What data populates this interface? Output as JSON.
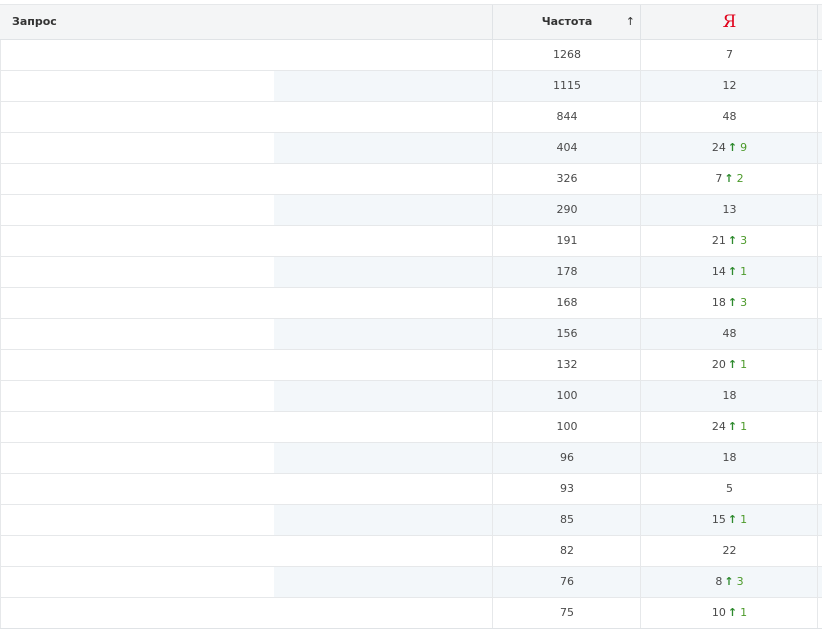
{
  "header": {
    "query_label": "Запрос",
    "freq_label": "Частота",
    "sort_glyph": "↑",
    "yandex_logo": "Я"
  },
  "rows": [
    {
      "freq": "1268",
      "pos": "7",
      "delta": ""
    },
    {
      "freq": "1115",
      "pos": "12",
      "delta": ""
    },
    {
      "freq": "844",
      "pos": "48",
      "delta": ""
    },
    {
      "freq": "404",
      "pos": "24",
      "delta": "9"
    },
    {
      "freq": "326",
      "pos": "7",
      "delta": "2"
    },
    {
      "freq": "290",
      "pos": "13",
      "delta": ""
    },
    {
      "freq": "191",
      "pos": "21",
      "delta": "3"
    },
    {
      "freq": "178",
      "pos": "14",
      "delta": "1"
    },
    {
      "freq": "168",
      "pos": "18",
      "delta": "3"
    },
    {
      "freq": "156",
      "pos": "48",
      "delta": ""
    },
    {
      "freq": "132",
      "pos": "20",
      "delta": "1"
    },
    {
      "freq": "100",
      "pos": "18",
      "delta": ""
    },
    {
      "freq": "100",
      "pos": "24",
      "delta": "1"
    },
    {
      "freq": "96",
      "pos": "18",
      "delta": ""
    },
    {
      "freq": "93",
      "pos": "5",
      "delta": ""
    },
    {
      "freq": "85",
      "pos": "15",
      "delta": "1"
    },
    {
      "freq": "82",
      "pos": "22",
      "delta": ""
    },
    {
      "freq": "76",
      "pos": "8",
      "delta": "3"
    },
    {
      "freq": "75",
      "pos": "10",
      "delta": "1"
    }
  ],
  "colors": {
    "yandex_red": "#e0001a",
    "up_green": "#2d8a2d",
    "stripe": "#f3f7fa"
  }
}
